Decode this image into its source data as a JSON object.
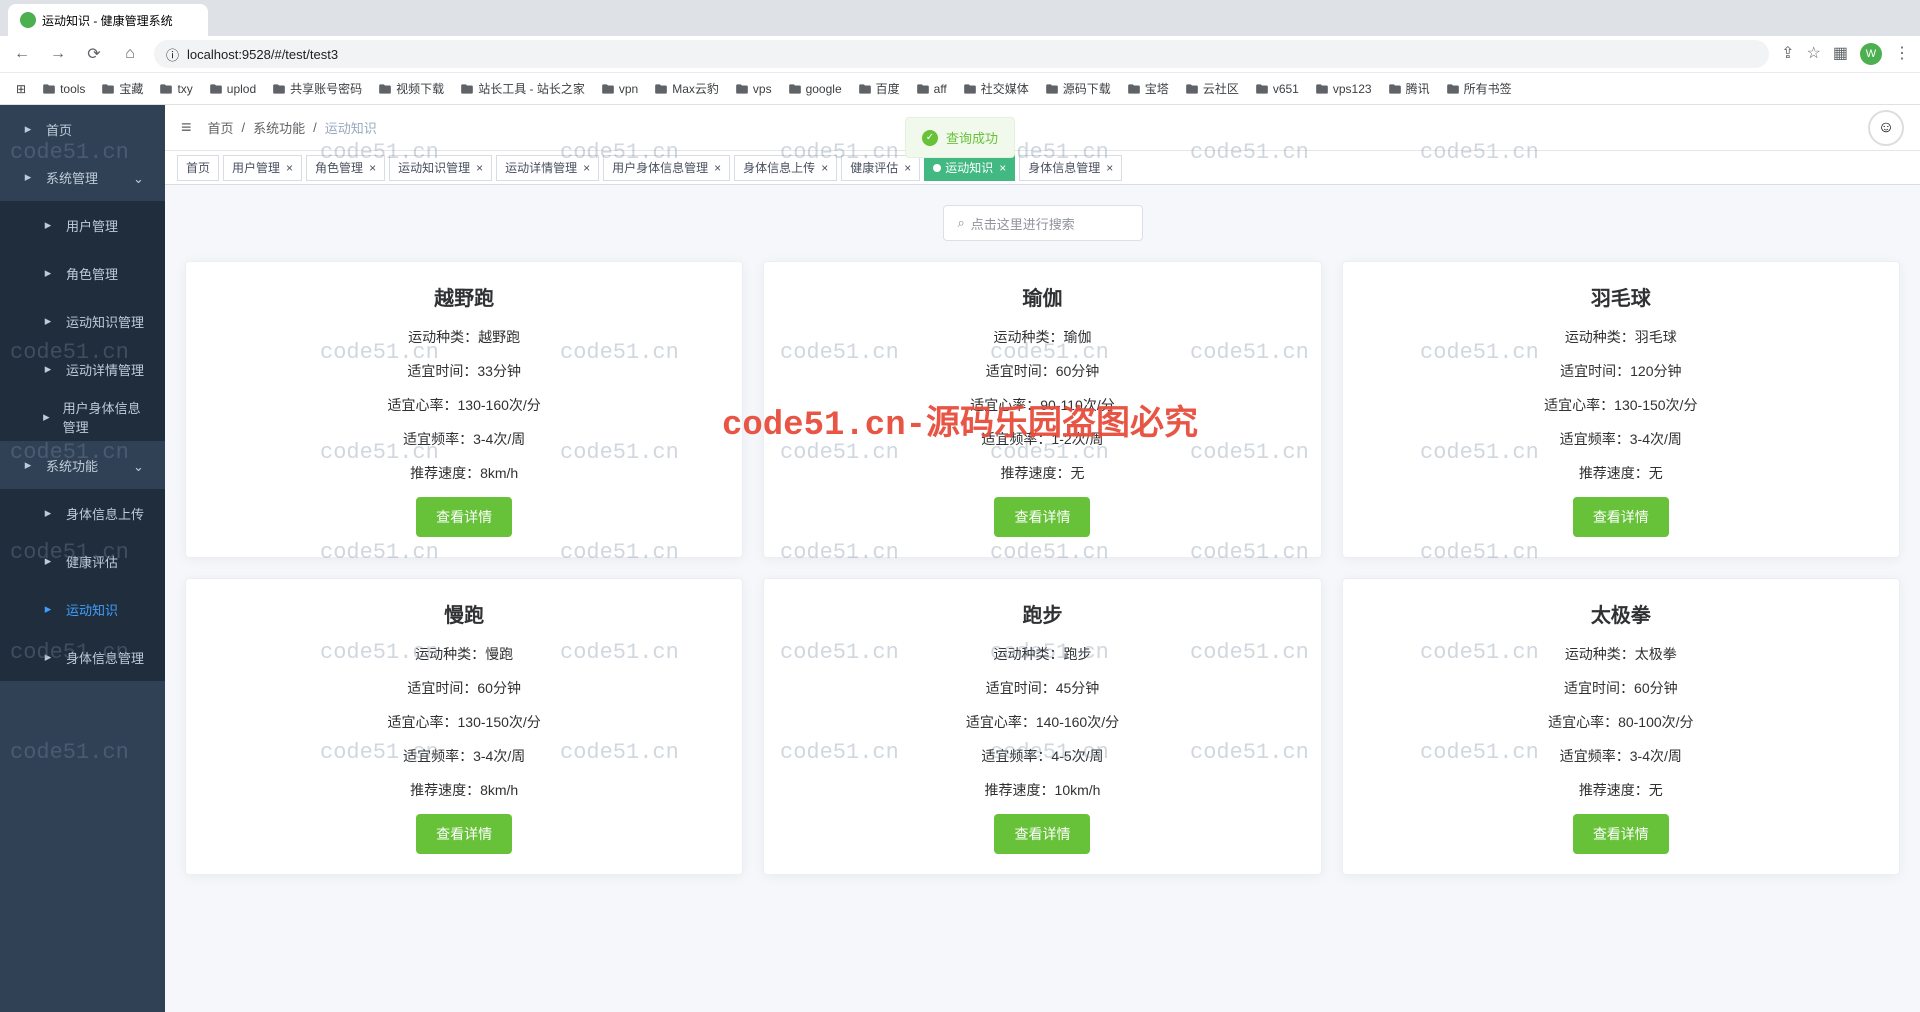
{
  "browser": {
    "tab_title": "运动知识 - 健康管理系统",
    "url": "localhost:9528/#/test/test3",
    "info_icon": "ⓘ"
  },
  "bookmarks": [
    "tools",
    "宝藏",
    "txy",
    "uplod",
    "共享账号密码",
    "视频下载",
    "站长工具 - 站长之家",
    "vpn",
    "Max云豹",
    "vps",
    "google",
    "百度",
    "aff",
    "社交媒体",
    "源码下载",
    "宝塔",
    "云社区",
    "v651",
    "vps123",
    "腾讯",
    "所有书签"
  ],
  "sidebar": {
    "items": [
      {
        "label": "首页",
        "icon": "dashboard"
      },
      {
        "label": "系统管理",
        "icon": "gear",
        "expand": true
      },
      {
        "label": "用户管理",
        "icon": "user",
        "sub": true
      },
      {
        "label": "角色管理",
        "icon": "role",
        "sub": true
      },
      {
        "label": "运动知识管理",
        "icon": "sport",
        "sub": true
      },
      {
        "label": "运动详情管理",
        "icon": "detail",
        "sub": true
      },
      {
        "label": "用户身体信息管理",
        "icon": "body",
        "sub": true
      },
      {
        "label": "系统功能",
        "icon": "func",
        "expand": true
      },
      {
        "label": "身体信息上传",
        "icon": "upload",
        "sub": true
      },
      {
        "label": "健康评估",
        "icon": "health",
        "sub": true
      },
      {
        "label": "运动知识",
        "icon": "bulb",
        "sub": true,
        "active": true
      },
      {
        "label": "身体信息管理",
        "icon": "manage",
        "sub": true
      }
    ]
  },
  "breadcrumb": [
    "首页",
    "系统功能",
    "运动知识"
  ],
  "tabs": [
    {
      "label": "首页"
    },
    {
      "label": "用户管理",
      "close": true
    },
    {
      "label": "角色管理",
      "close": true
    },
    {
      "label": "运动知识管理",
      "close": true
    },
    {
      "label": "运动详情管理",
      "close": true
    },
    {
      "label": "用户身体信息管理",
      "close": true
    },
    {
      "label": "身体信息上传",
      "close": true
    },
    {
      "label": "健康评估",
      "close": true
    },
    {
      "label": "运动知识",
      "close": true,
      "active": true
    },
    {
      "label": "身体信息管理",
      "close": true
    }
  ],
  "search_placeholder": "点击这里进行搜索",
  "toast_text": "查询成功",
  "labels": {
    "type": "运动种类：",
    "time": "适宜时间：",
    "hr": "适宜心率：",
    "freq": "适宜频率：",
    "speed": "推荐速度：",
    "view": "查看详情"
  },
  "cards": [
    {
      "title": "越野跑",
      "type": "越野跑",
      "time": "33分钟",
      "hr": "130-160次/分",
      "freq": "3-4次/周",
      "speed": "8km/h"
    },
    {
      "title": "瑜伽",
      "type": "瑜伽",
      "time": "60分钟",
      "hr": "90-110次/分",
      "freq": "1-2次/周",
      "speed": "无"
    },
    {
      "title": "羽毛球",
      "type": "羽毛球",
      "time": "120分钟",
      "hr": "130-150次/分",
      "freq": "3-4次/周",
      "speed": "无"
    },
    {
      "title": "慢跑",
      "type": "慢跑",
      "time": "60分钟",
      "hr": "130-150次/分",
      "freq": "3-4次/周",
      "speed": "8km/h"
    },
    {
      "title": "跑步",
      "type": "跑步",
      "time": "45分钟",
      "hr": "140-160次/分",
      "freq": "4-5次/周",
      "speed": "10km/h"
    },
    {
      "title": "太极拳",
      "type": "太极拳",
      "time": "60分钟",
      "hr": "80-100次/分",
      "freq": "3-4次/周",
      "speed": "无"
    }
  ],
  "watermark_text": "code51.cn",
  "watermark_big": "code51.cn-源码乐园盗图必究"
}
